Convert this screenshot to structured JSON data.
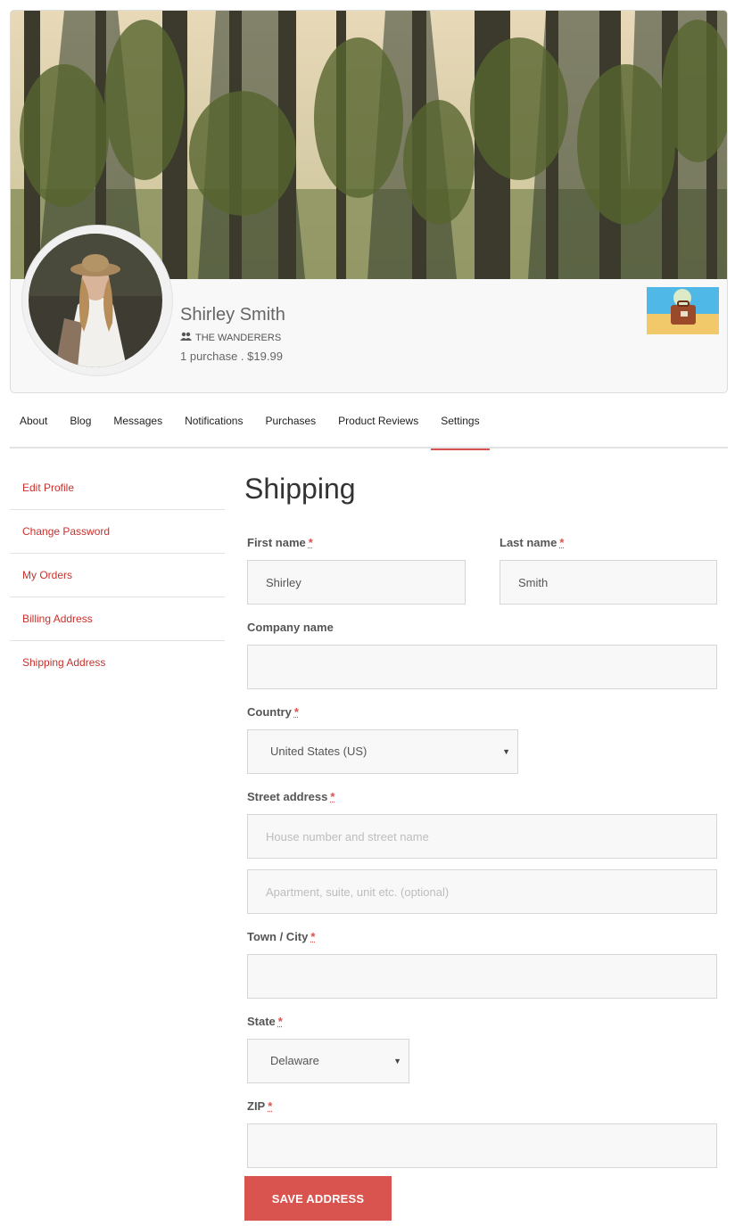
{
  "profile": {
    "name": "Shirley Smith",
    "group": "THE WANDERERS",
    "purchases": "1 purchase . $19.99",
    "cover_icon": "forest-cover-image",
    "avatar_icon": "user-avatar-photo",
    "group_icon": "users-icon",
    "badge_icon": "suitcase-beach-badge"
  },
  "tabs": [
    {
      "label": "About"
    },
    {
      "label": "Blog"
    },
    {
      "label": "Messages"
    },
    {
      "label": "Notifications"
    },
    {
      "label": "Purchases"
    },
    {
      "label": "Product Reviews"
    },
    {
      "label": "Settings",
      "active": true
    }
  ],
  "side_menu": [
    {
      "label": "Edit Profile"
    },
    {
      "label": "Change Password"
    },
    {
      "label": "My Orders"
    },
    {
      "label": "Billing Address"
    },
    {
      "label": "Shipping Address"
    }
  ],
  "form": {
    "heading": "Shipping",
    "required_marker": "*",
    "first_name": {
      "label": "First name",
      "value": "Shirley"
    },
    "last_name": {
      "label": "Last name",
      "value": "Smith"
    },
    "company": {
      "label": "Company name",
      "value": ""
    },
    "country": {
      "label": "Country",
      "value": "United States (US)"
    },
    "street": {
      "label": "Street address",
      "placeholder1": "House number and street name",
      "placeholder2": "Apartment, suite, unit etc. (optional)"
    },
    "city": {
      "label": "Town / City",
      "value": ""
    },
    "state": {
      "label": "State",
      "value": "Delaware"
    },
    "zip": {
      "label": "ZIP",
      "value": ""
    },
    "save_label": "SAVE ADDRESS"
  },
  "colors": {
    "accent": "#d9534f",
    "link": "#c9302c",
    "field_bg": "#f8f8f8",
    "border": "#d6d6d6"
  }
}
